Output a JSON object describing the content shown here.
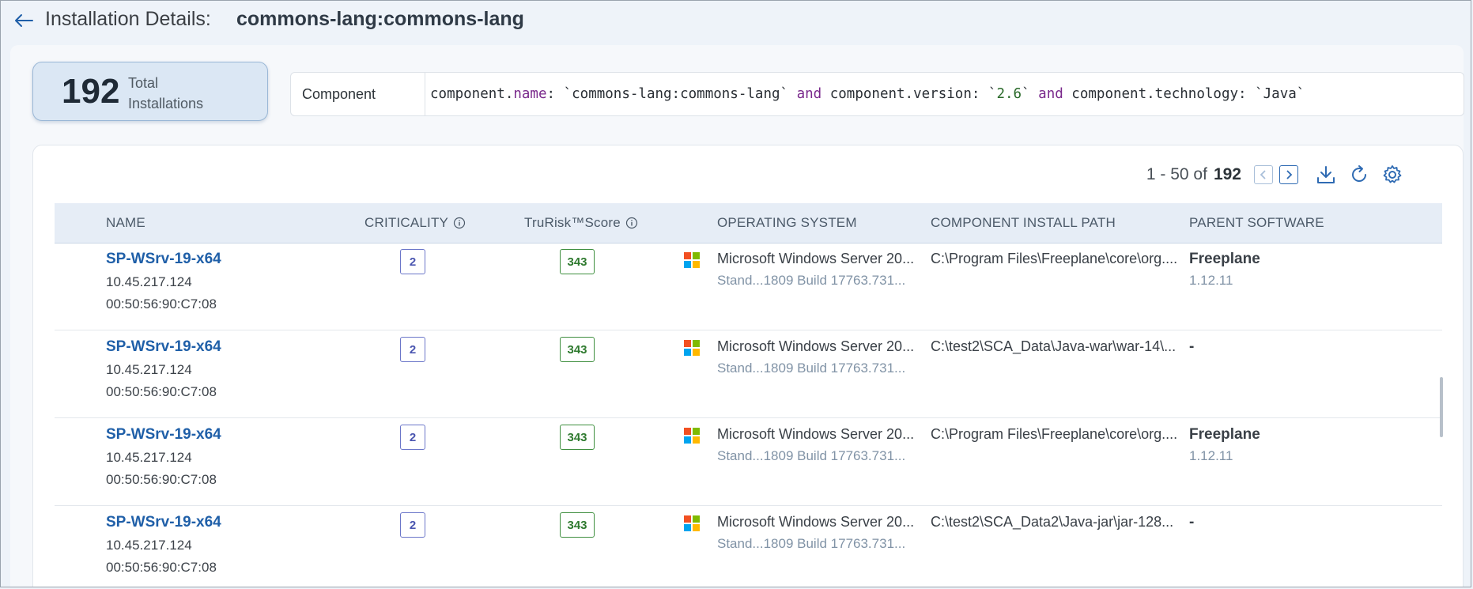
{
  "header": {
    "title_label": "Installation Details:",
    "title_value": "commons-lang:commons-lang"
  },
  "summary": {
    "count": "192",
    "label": "Total Installations"
  },
  "query": {
    "label": "Component",
    "tokens": [
      {
        "text": "component.",
        "type": "plain"
      },
      {
        "text": "name",
        "type": "kw"
      },
      {
        "text": ": `commons-lang:commons-lang` ",
        "type": "plain"
      },
      {
        "text": "and",
        "type": "kw"
      },
      {
        "text": " component.version: `",
        "type": "plain"
      },
      {
        "text": "2.6",
        "type": "str"
      },
      {
        "text": "` ",
        "type": "plain"
      },
      {
        "text": "and",
        "type": "kw"
      },
      {
        "text": " component.technology: `Java`",
        "type": "plain"
      }
    ]
  },
  "pager": {
    "range": "1 - 50 of",
    "total": "192"
  },
  "columns": {
    "name": "NAME",
    "criticality": "CRITICALITY",
    "trurisk": "TruRisk™Score",
    "os": "OPERATING SYSTEM",
    "path": "COMPONENT INSTALL PATH",
    "parent": "PARENT SOFTWARE"
  },
  "rows": [
    {
      "host": "SP-WSrv-19-x64",
      "ip": "10.45.217.124",
      "mac": "00:50:56:90:C7:08",
      "criticality": "2",
      "score": "343",
      "os": "Microsoft Windows Server 20...",
      "os_detail": "Stand...1809 Build 17763.731...",
      "path": "C:\\Program Files\\Freeplane\\core\\org....",
      "parent": "Freeplane",
      "parent_version": "1.12.11"
    },
    {
      "host": "SP-WSrv-19-x64",
      "ip": "10.45.217.124",
      "mac": "00:50:56:90:C7:08",
      "criticality": "2",
      "score": "343",
      "os": "Microsoft Windows Server 20...",
      "os_detail": "Stand...1809 Build 17763.731...",
      "path": "C:\\test2\\SCA_Data\\Java-war\\war-14\\...",
      "parent": "-",
      "parent_version": ""
    },
    {
      "host": "SP-WSrv-19-x64",
      "ip": "10.45.217.124",
      "mac": "00:50:56:90:C7:08",
      "criticality": "2",
      "score": "343",
      "os": "Microsoft Windows Server 20...",
      "os_detail": "Stand...1809 Build 17763.731...",
      "path": "C:\\Program Files\\Freeplane\\core\\org....",
      "parent": "Freeplane",
      "parent_version": "1.12.11"
    },
    {
      "host": "SP-WSrv-19-x64",
      "ip": "10.45.217.124",
      "mac": "00:50:56:90:C7:08",
      "criticality": "2",
      "score": "343",
      "os": "Microsoft Windows Server 20...",
      "os_detail": "Stand...1809 Build 17763.731...",
      "path": "C:\\test2\\SCA_Data2\\Java-jar\\jar-128...",
      "parent": "-",
      "parent_version": ""
    }
  ],
  "icons": {
    "back": "arrow-left-icon",
    "info": "info-icon",
    "prev": "chevron-left-icon",
    "next": "chevron-right-icon",
    "download": "download-icon",
    "refresh": "refresh-icon",
    "settings": "gear-icon",
    "os": "windows-logo-icon"
  },
  "colors": {
    "accent": "#1f5fa8",
    "criticality_border": "#6b76c9",
    "score_border": "#3f8f3f"
  }
}
